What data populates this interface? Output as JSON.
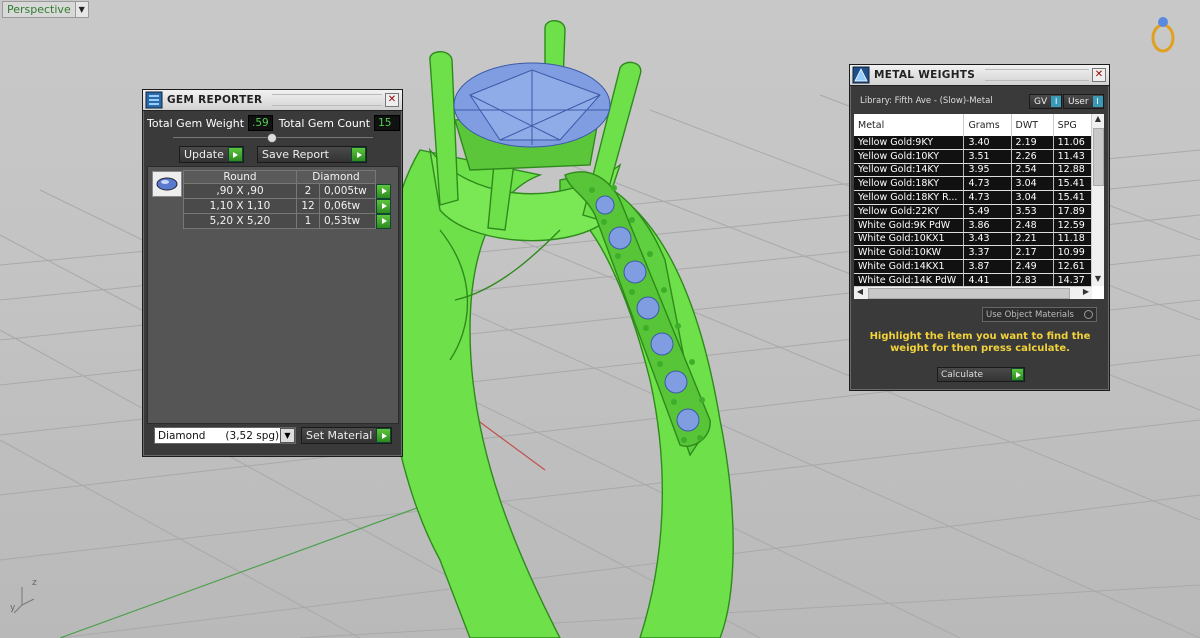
{
  "viewport": {
    "label": "Perspective",
    "axis_labels": [
      "z",
      "y"
    ]
  },
  "gem_reporter": {
    "title": "GEM REPORTER",
    "total_weight_label": "Total Gem Weight",
    "total_weight_value": ".59",
    "total_count_label": "Total Gem Count",
    "total_count_value": "15",
    "update_label": "Update",
    "save_report_label": "Save Report",
    "shape_header": "Round",
    "material_header": "Diamond",
    "rows": [
      {
        "size": ",90 X ,90",
        "count": "2",
        "weight": "0,005tw"
      },
      {
        "size": "1,10 X 1,10",
        "count": "12",
        "weight": "0,06tw"
      },
      {
        "size": "5,20 X 5,20",
        "count": "1",
        "weight": "0,53tw"
      }
    ],
    "material_select": "Diamond      (3,52 spg)",
    "set_material_label": "Set Material"
  },
  "metal_weights": {
    "title": "METAL WEIGHTS",
    "library_label": "Library: Fifth Ave - (Slow)-Metal",
    "gv_label": "GV",
    "user_label": "User",
    "columns": [
      "Metal",
      "Grams",
      "DWT",
      "SPG"
    ],
    "rows": [
      {
        "metal": "Yellow Gold:9KY",
        "grams": "3.40",
        "dwt": "2.19",
        "spg": "11.06"
      },
      {
        "metal": "Yellow Gold:10KY",
        "grams": "3.51",
        "dwt": "2.26",
        "spg": "11.43"
      },
      {
        "metal": "Yellow Gold:14KY",
        "grams": "3.95",
        "dwt": "2.54",
        "spg": "12.88"
      },
      {
        "metal": "Yellow Gold:18KY",
        "grams": "4.73",
        "dwt": "3.04",
        "spg": "15.41"
      },
      {
        "metal": "Yellow Gold:18KY R...",
        "grams": "4.73",
        "dwt": "3.04",
        "spg": "15.41"
      },
      {
        "metal": "Yellow Gold:22KY",
        "grams": "5.49",
        "dwt": "3.53",
        "spg": "17.89"
      },
      {
        "metal": "White Gold:9K PdW",
        "grams": "3.86",
        "dwt": "2.48",
        "spg": "12.59"
      },
      {
        "metal": "White Gold:10KX1",
        "grams": "3.43",
        "dwt": "2.21",
        "spg": "11.18"
      },
      {
        "metal": "White Gold:10KW",
        "grams": "3.37",
        "dwt": "2.17",
        "spg": "10.99"
      },
      {
        "metal": "White Gold:14KX1",
        "grams": "3.87",
        "dwt": "2.49",
        "spg": "12.61"
      },
      {
        "metal": "White Gold:14K PdW",
        "grams": "4.41",
        "dwt": "2.83",
        "spg": "14.37"
      }
    ],
    "use_object_label": "Use Object Materials",
    "instruction": "Highlight the item you want to find the weight for then press calculate.",
    "calculate_label": "Calculate"
  },
  "colors": {
    "ring_green": "#6ee04a",
    "gem_blue": "#7f9de0",
    "panel_bg": "#3a3a3a",
    "instruction_yellow": "#f2d23a"
  }
}
